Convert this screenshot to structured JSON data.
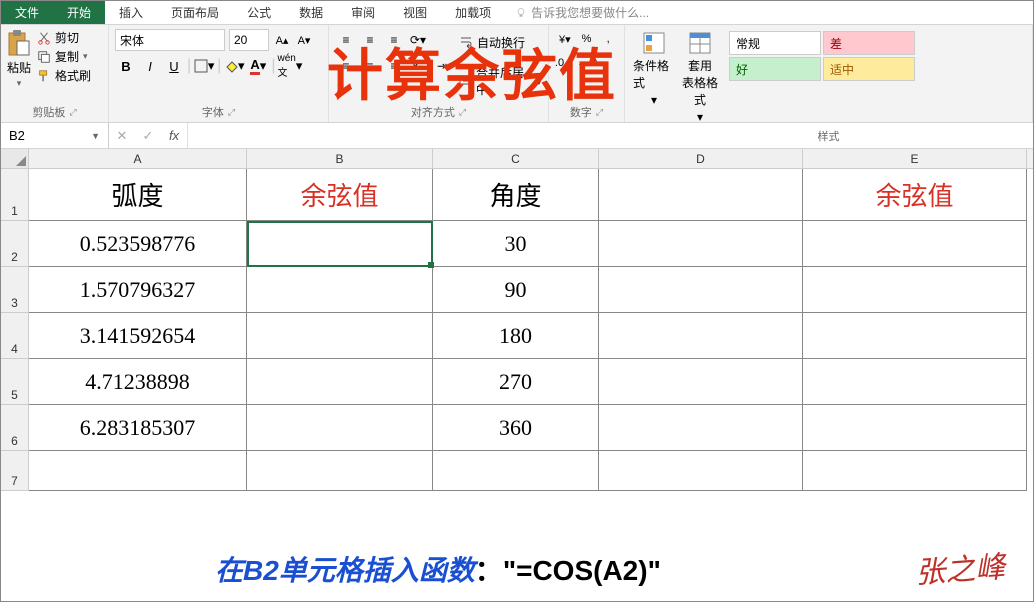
{
  "tabs": {
    "file": "文件",
    "home": "开始",
    "insert": "插入",
    "layout": "页面布局",
    "formulas": "公式",
    "data": "数据",
    "review": "审阅",
    "view": "视图",
    "addins": "加载项",
    "tellme": "告诉我您想要做什么..."
  },
  "ribbon": {
    "clipboard": {
      "label": "剪贴板",
      "paste": "粘贴",
      "cut": "剪切",
      "copy": "复制",
      "painter": "格式刷"
    },
    "font": {
      "label": "字体",
      "name": "宋体",
      "size": "20",
      "bold": "B",
      "italic": "I",
      "underline": "U"
    },
    "align": {
      "label": "对齐方式",
      "wrap": "自动换行",
      "merge": "合并后居中"
    },
    "number": {
      "label": "数字"
    },
    "styles": {
      "label": "样式",
      "condfmt": "条件格式",
      "tablefmt": "套用\n表格格式",
      "normal": "常规",
      "bad": "差",
      "good": "好",
      "neutral": "适中"
    }
  },
  "overlay_title": "计算余弦值",
  "formula_bar": {
    "namebox": "B2",
    "formula": ""
  },
  "columns": [
    "A",
    "B",
    "C",
    "D",
    "E"
  ],
  "row_nums": [
    "1",
    "2",
    "3",
    "4",
    "5",
    "6",
    "7"
  ],
  "headers": {
    "a": "弧度",
    "b": "余弦值",
    "c": "角度",
    "e": "余弦值"
  },
  "data_rows": [
    {
      "a": "0.523598776",
      "c": "30"
    },
    {
      "a": "1.570796327",
      "c": "90"
    },
    {
      "a": "3.141592654",
      "c": "180"
    },
    {
      "a": "4.71238898",
      "c": "270"
    },
    {
      "a": "6.283185307",
      "c": "360"
    }
  ],
  "bottom_note": {
    "pre": "在B2单元格插入函数",
    "colon": "：",
    "quote1": "\"",
    "formula": "=COS(A2)",
    "quote2": "\""
  },
  "signature": "张之峰"
}
